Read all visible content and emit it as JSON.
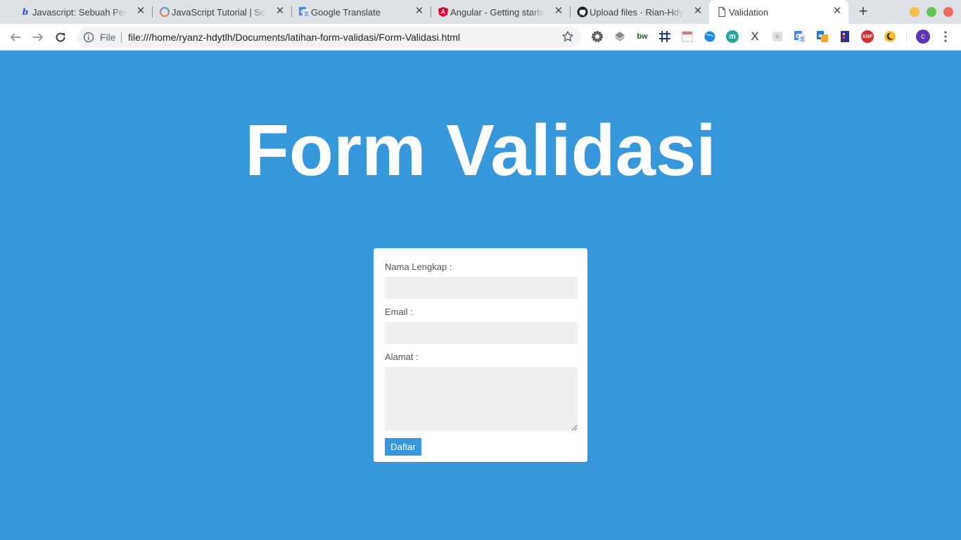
{
  "browser": {
    "tabs": [
      {
        "title": "Javascript: Sebuah Pembelajaran",
        "icon": "b-logo-icon",
        "active": false
      },
      {
        "title": "JavaScript Tutorial | SoloLearn",
        "icon": "sololearn-icon",
        "active": false
      },
      {
        "title": "Google Translate",
        "icon": "google-translate-icon",
        "active": false
      },
      {
        "title": "Angular - Getting started",
        "icon": "angular-icon",
        "active": false
      },
      {
        "title": "Upload files · Rian-Hdytlh",
        "icon": "github-icon",
        "active": false
      },
      {
        "title": "Validation",
        "icon": "document-icon",
        "active": true
      }
    ],
    "omnibox": {
      "scheme_label": "File",
      "url": "file:///home/ryanz-hdytlh/Documents/latihan-form-validasi/Form-Validasi.html"
    },
    "profile_initial": "c",
    "extensions": [
      "settings-gear-ext",
      "layers-ext",
      "bw-ext",
      "grid-ext",
      "calendar-ext",
      "globe-ext",
      "m-ext",
      "x-ext",
      "puzzle-ext",
      "translate-ext",
      "dictionary-ext",
      "tag-ext",
      "adblock-ext",
      "moon-ext"
    ],
    "extension_labels": {
      "bw": "bw",
      "m": "m",
      "x": "X",
      "adblock": "ABP"
    },
    "colors": {
      "tabstrip_bg": "#dee1e6",
      "toolbar_bg": "#ffffff",
      "close_red": "#ed6a5e",
      "minimize_yellow": "#f6be4f",
      "maximize_green": "#61c554"
    }
  },
  "page": {
    "background": "#3698db",
    "title": "Form Validasi",
    "form": {
      "name_label": "Nama Lengkap :",
      "name_value": "",
      "email_label": "Email :",
      "email_value": "",
      "address_label": "Alamat :",
      "address_value": "",
      "submit_label": "Daftar"
    }
  }
}
